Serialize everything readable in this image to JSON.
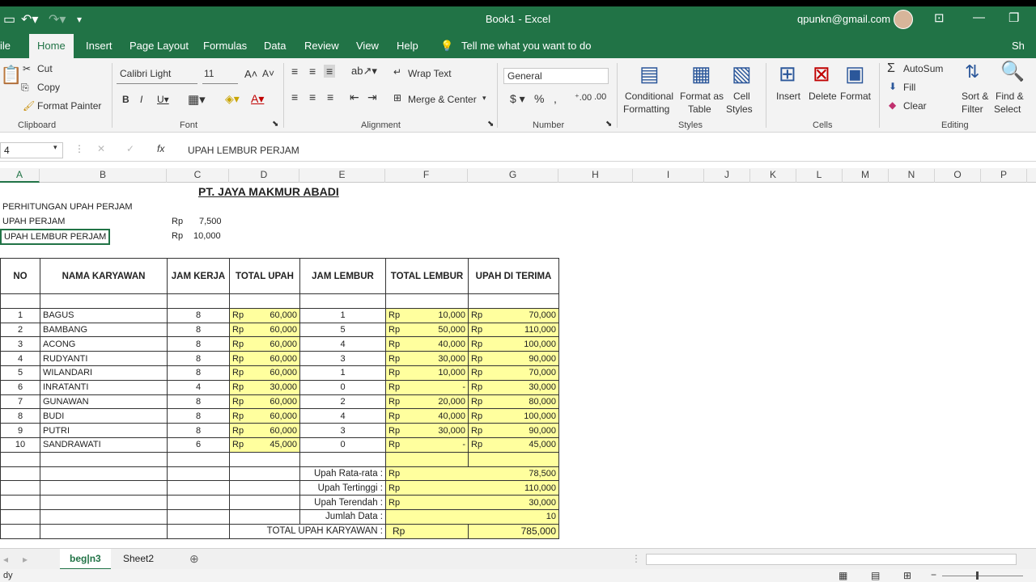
{
  "window": {
    "title": "Book1  -  Excel",
    "account": "qpunkn@gmail.com"
  },
  "menu": {
    "file": "ile",
    "home": "Home",
    "insert": "Insert",
    "page_layout": "Page Layout",
    "formulas": "Formulas",
    "data": "Data",
    "review": "Review",
    "view": "View",
    "help": "Help",
    "tell_me": "Tell me what you want to do",
    "share": "Sh"
  },
  "ribbon": {
    "cut": "Cut",
    "copy": "Copy",
    "format_painter": "Format Painter",
    "clipboard": "Clipboard",
    "font_name": "Calibri Light",
    "font_size": "11",
    "font": "Font",
    "wrap_text": "Wrap Text",
    "merge_center": "Merge & Center",
    "alignment": "Alignment",
    "number_format": "General",
    "number": "Number",
    "cond_fmt1": "Conditional",
    "cond_fmt2": "Formatting",
    "fmt_table1": "Format as",
    "fmt_table2": "Table",
    "cell_styles1": "Cell",
    "cell_styles2": "Styles",
    "styles": "Styles",
    "insert": "Insert",
    "delete": "Delete",
    "format": "Format",
    "cells": "Cells",
    "autosum": "AutoSum",
    "fill": "Fill",
    "clear": "Clear",
    "sort1": "Sort &",
    "sort2": "Filter",
    "find1": "Find &",
    "find2": "Select",
    "editing": "Editing"
  },
  "formula_bar": {
    "name_box": "4",
    "fx": "fx",
    "content": "UPAH LEMBUR PERJAM"
  },
  "columns": [
    "A",
    "B",
    "C",
    "D",
    "E",
    "F",
    "G",
    "H",
    "I",
    "J",
    "K",
    "L",
    "M",
    "N",
    "O",
    "P"
  ],
  "sheet": {
    "company": "PT. JAYA MAKMUR ABADI",
    "subtitle": "PERHITUNGAN UPAH PERJAM",
    "upah_label": "UPAH PERJAM",
    "upah_rp": "Rp",
    "upah_val": "7,500",
    "lembur_label": "UPAH LEMBUR PERJAM",
    "lembur_rp": "Rp",
    "lembur_val": "10,000",
    "headers": [
      "NO",
      "NAMA KARYAWAN",
      "JAM KERJA",
      "TOTAL UPAH",
      "JAM LEMBUR",
      "TOTAL LEMBUR",
      "UPAH DI TERIMA"
    ],
    "rp": "Rp",
    "rows": [
      {
        "no": "1",
        "nama": "BAGUS",
        "jam": "8",
        "upah": "60,000",
        "lembur": "1",
        "tlembur": "10,000",
        "terima": "70,000"
      },
      {
        "no": "2",
        "nama": "BAMBANG",
        "jam": "8",
        "upah": "60,000",
        "lembur": "5",
        "tlembur": "50,000",
        "terima": "110,000"
      },
      {
        "no": "3",
        "nama": "ACONG",
        "jam": "8",
        "upah": "60,000",
        "lembur": "4",
        "tlembur": "40,000",
        "terima": "100,000"
      },
      {
        "no": "4",
        "nama": "RUDYANTI",
        "jam": "8",
        "upah": "60,000",
        "lembur": "3",
        "tlembur": "30,000",
        "terima": "90,000"
      },
      {
        "no": "5",
        "nama": "WILANDARI",
        "jam": "8",
        "upah": "60,000",
        "lembur": "1",
        "tlembur": "10,000",
        "terima": "70,000"
      },
      {
        "no": "6",
        "nama": "INRATANTI",
        "jam": "4",
        "upah": "30,000",
        "lembur": "0",
        "tlembur": "-",
        "terima": "30,000"
      },
      {
        "no": "7",
        "nama": "GUNAWAN",
        "jam": "8",
        "upah": "60,000",
        "lembur": "2",
        "tlembur": "20,000",
        "terima": "80,000"
      },
      {
        "no": "8",
        "nama": "BUDI",
        "jam": "8",
        "upah": "60,000",
        "lembur": "4",
        "tlembur": "40,000",
        "terima": "100,000"
      },
      {
        "no": "9",
        "nama": "PUTRI",
        "jam": "8",
        "upah": "60,000",
        "lembur": "3",
        "tlembur": "30,000",
        "terima": "90,000"
      },
      {
        "no": "10",
        "nama": "SANDRAWATI",
        "jam": "6",
        "upah": "45,000",
        "lembur": "0",
        "tlembur": "-",
        "terima": "45,000"
      }
    ],
    "summary": [
      {
        "label": "Upah Rata-rata :",
        "rp": "Rp",
        "value": "78,500"
      },
      {
        "label": "Upah Tertinggi :",
        "rp": "Rp",
        "value": "110,000"
      },
      {
        "label": "Upah Terendah :",
        "rp": "Rp",
        "value": "30,000"
      },
      {
        "label": "Jumlah Data :",
        "rp": "",
        "value": "10"
      }
    ],
    "total_label": "TOTAL UPAH KARYAWAN :",
    "total_rp": "Rp",
    "total_value": "785,000"
  },
  "tabs": {
    "tab1": "beg|n3",
    "tab2": "Sheet2"
  },
  "status": {
    "ready": "dy"
  }
}
